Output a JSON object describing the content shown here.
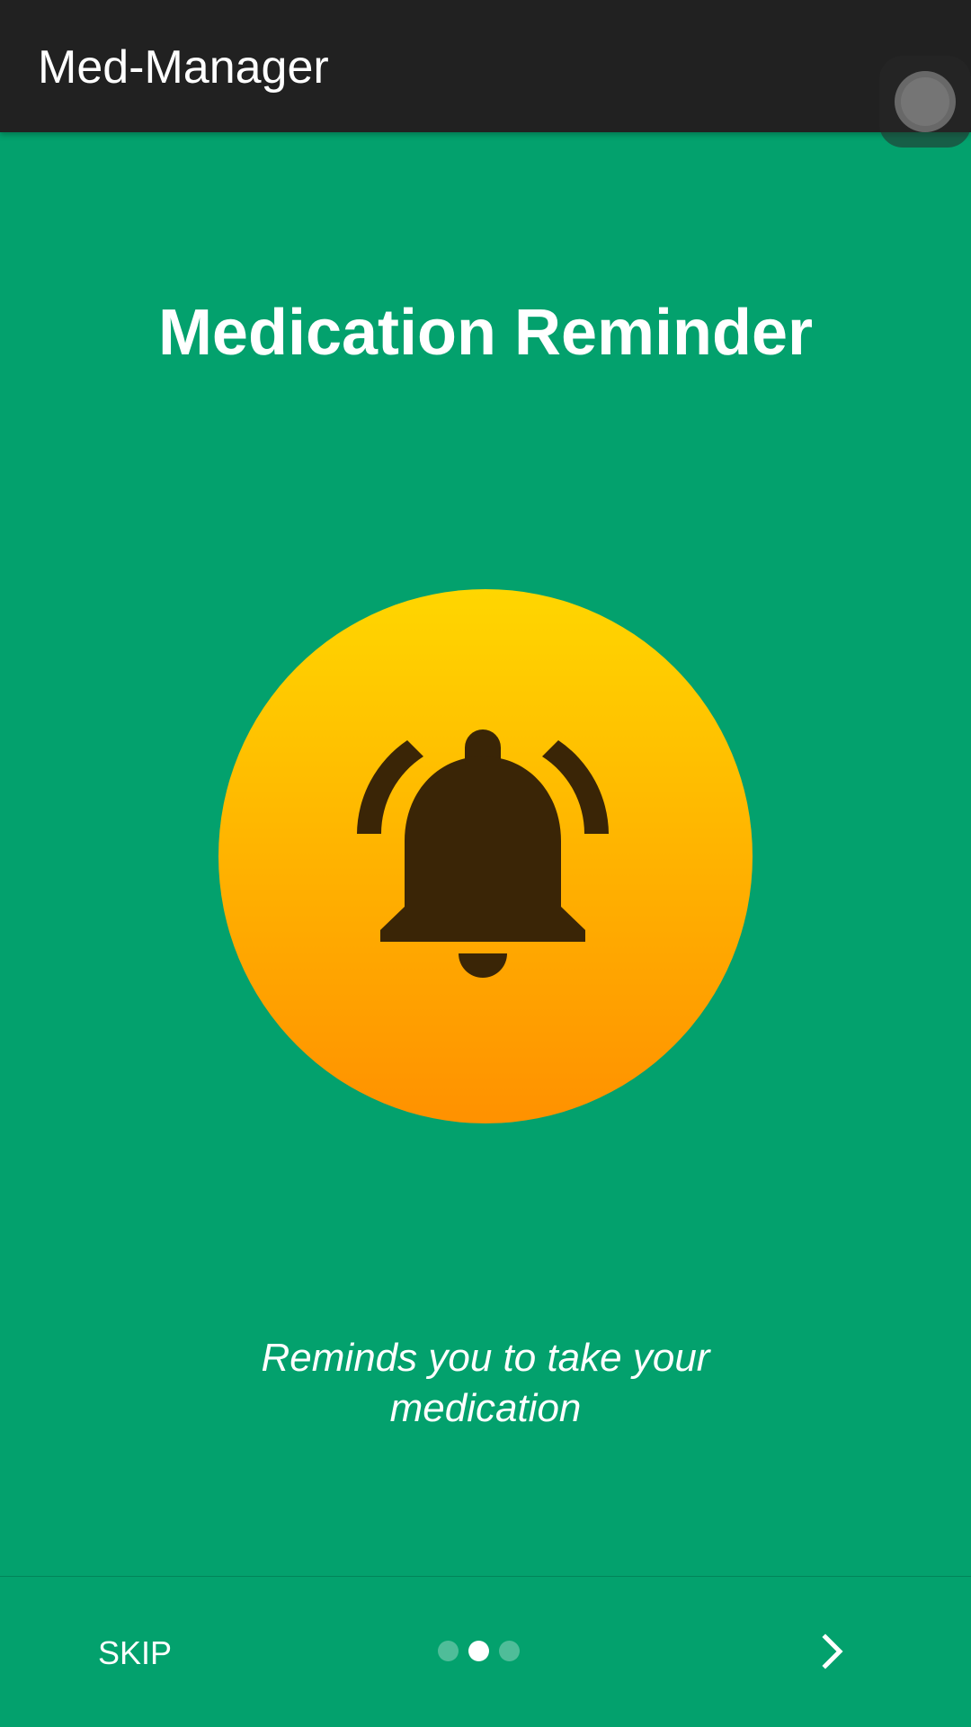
{
  "app_bar": {
    "title": "Med-Manager"
  },
  "slide": {
    "title": "Medication Reminder",
    "icon": "bell-ringing-icon",
    "description": "Reminds you to take your medication"
  },
  "navigation": {
    "skip_label": "SKIP",
    "next_icon": "chevron-right-icon",
    "page_count": 3,
    "current_page": 2
  },
  "colors": {
    "background": "#03A16D",
    "app_bar": "#212121",
    "icon_circle_top": "#FFD600",
    "icon_circle_bottom": "#FF9100",
    "bell": "#3A2506",
    "text": "#FFFFFF"
  }
}
